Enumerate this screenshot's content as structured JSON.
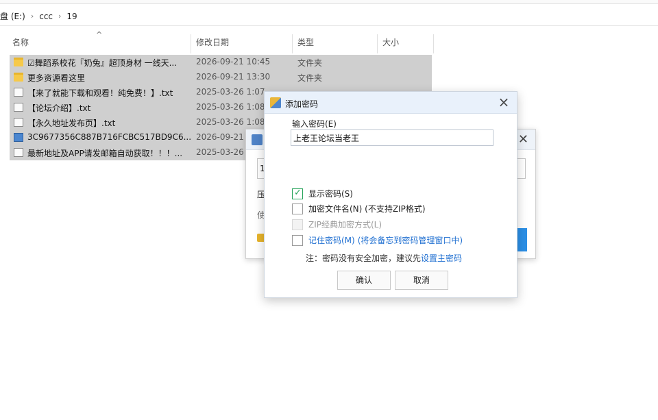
{
  "explorer": {
    "breadcrumb": [
      "盘 (E:)",
      "ccc",
      "19"
    ],
    "columns": [
      "名称",
      "修改日期",
      "类型",
      "大小"
    ],
    "files": [
      {
        "icon": "folder-icon",
        "name": "☑舞蹈系校花『奶兔』超顶身材 一线天...",
        "date": "2026-09-21 10:45",
        "type": "文件夹",
        "size": ""
      },
      {
        "icon": "folder-icon",
        "name": "更多资源看这里",
        "date": "2026-09-21 13:30",
        "type": "文件夹",
        "size": ""
      },
      {
        "icon": "text-file-icon",
        "name": "【来了就能下载和观看！纯免费！】.txt",
        "date": "2025-03-26 1:07",
        "type": "",
        "size": ""
      },
      {
        "icon": "text-file-icon",
        "name": "【论坛介绍】.txt",
        "date": "2025-03-26 1:08",
        "type": "",
        "size": ""
      },
      {
        "icon": "text-file-icon",
        "name": "【永久地址发布页】.txt",
        "date": "2025-03-26 1:08",
        "type": "",
        "size": ""
      },
      {
        "icon": "image-file-icon",
        "name": "3C9677356C887B716FCBC517BD9C6...",
        "date": "2026-09-21",
        "type": "",
        "size": ""
      },
      {
        "icon": "text-file-icon",
        "name": "最新地址及APP请发邮箱自动获取！！！...",
        "date": "2025-03-26",
        "type": "",
        "size": ""
      }
    ]
  },
  "background_dialog": {
    "field_start": "1",
    "row2_start": "压",
    "row3_start": "使"
  },
  "dialog": {
    "title": "添加密码",
    "password_label": "输入密码(E)",
    "password_value": "上老王论坛当老王",
    "options": [
      {
        "label": "显示密码(S)",
        "checked": true,
        "disabled": false
      },
      {
        "label": "加密文件名(N) (不支持ZIP格式)",
        "checked": false,
        "disabled": false
      },
      {
        "label": "ZIP经典加密方式(L)",
        "checked": false,
        "disabled": true
      }
    ],
    "remember": {
      "label": "记住密码(M)",
      "hint": "(将会备忘到密码管理窗口中)"
    },
    "note_prefix": "注：密码没有安全加密，建议先",
    "note_link": "设置主密码",
    "ok_label": "确认",
    "cancel_label": "取消"
  },
  "colors": {
    "selection": "#cfcfcf",
    "link": "#1f6fd1",
    "check": "#27a35a",
    "accent_button": "#2b8fe6"
  }
}
